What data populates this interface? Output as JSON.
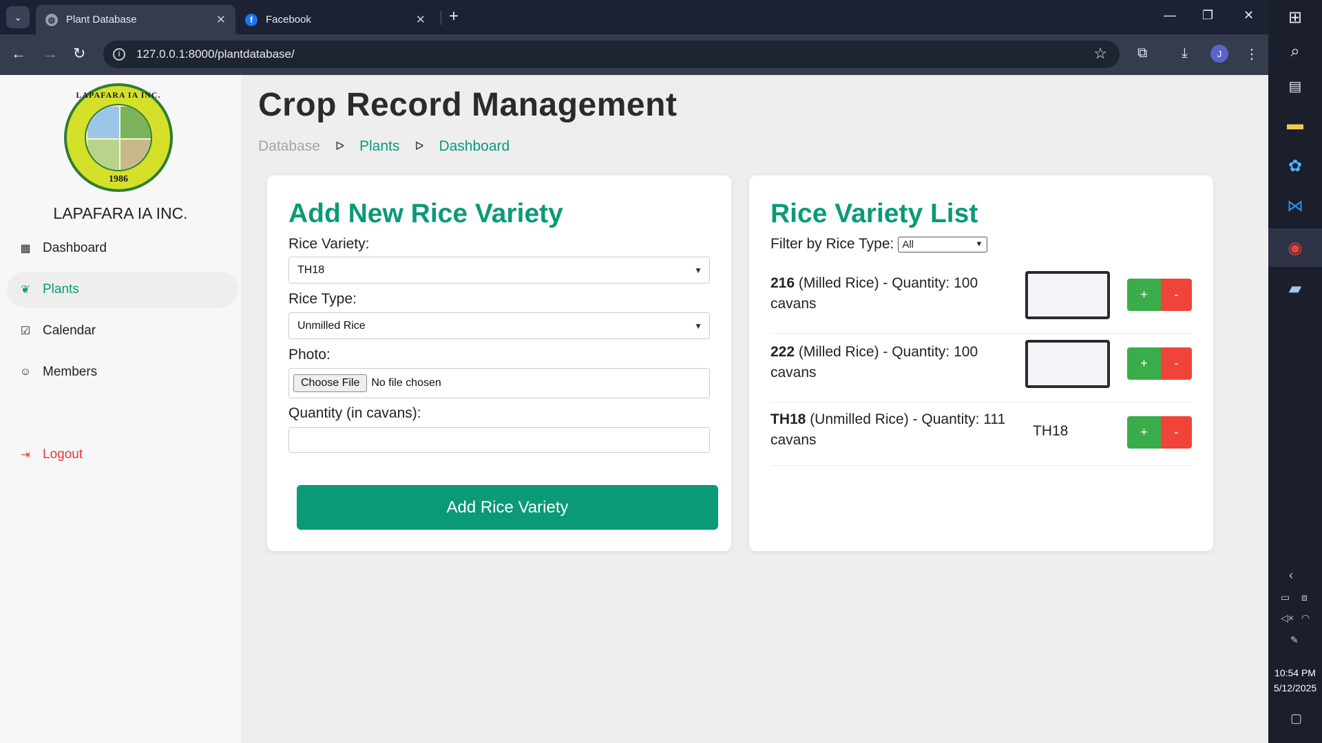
{
  "browser": {
    "tabs": [
      {
        "title": "Plant Database"
      },
      {
        "title": "Facebook"
      }
    ],
    "url": "127.0.0.1:8000/plantdatabase/",
    "profile_initial": "J"
  },
  "taskbar": {
    "time": "10:54 PM",
    "date": "5/12/2025"
  },
  "sidebar": {
    "org_name": "LAPAFARA IA INC.",
    "logo_ring_text": "LAPAFARA IA INC.",
    "logo_year": "1986",
    "nav": [
      {
        "label": "Dashboard",
        "icon": "grid-icon"
      },
      {
        "label": "Plants",
        "icon": "leaf-icon"
      },
      {
        "label": "Calendar",
        "icon": "calendar-icon"
      },
      {
        "label": "Members",
        "icon": "users-icon"
      }
    ],
    "logout_label": "Logout"
  },
  "header": {
    "title": "Crop Record Management",
    "breadcrumb": [
      "Database",
      "Plants",
      "Dashboard"
    ]
  },
  "form": {
    "title": "Add New Rice Variety",
    "variety_label": "Rice Variety:",
    "variety_value": "TH18",
    "type_label": "Rice Type:",
    "type_value": "Unmilled Rice",
    "photo_label": "Photo:",
    "file_button": "Choose File",
    "file_status": "No file chosen",
    "quantity_label": "Quantity (in cavans):",
    "quantity_value": "",
    "submit_label": "Add Rice Variety"
  },
  "list": {
    "title": "Rice Variety List",
    "filter_label": "Filter by Rice Type:",
    "filter_value": "All",
    "items": [
      {
        "name": "216",
        "rest": " (Milled Rice) - Quantity: 100 cavans",
        "photo": "thumbnail"
      },
      {
        "name": "222",
        "rest": " (Milled Rice) - Quantity: 100 cavans",
        "photo": "thumbnail"
      },
      {
        "name": "TH18",
        "rest": " (Unmilled Rice) - Quantity: 111 cavans",
        "photo_alt": "TH18"
      }
    ],
    "plus_label": "+",
    "minus_label": "-"
  }
}
